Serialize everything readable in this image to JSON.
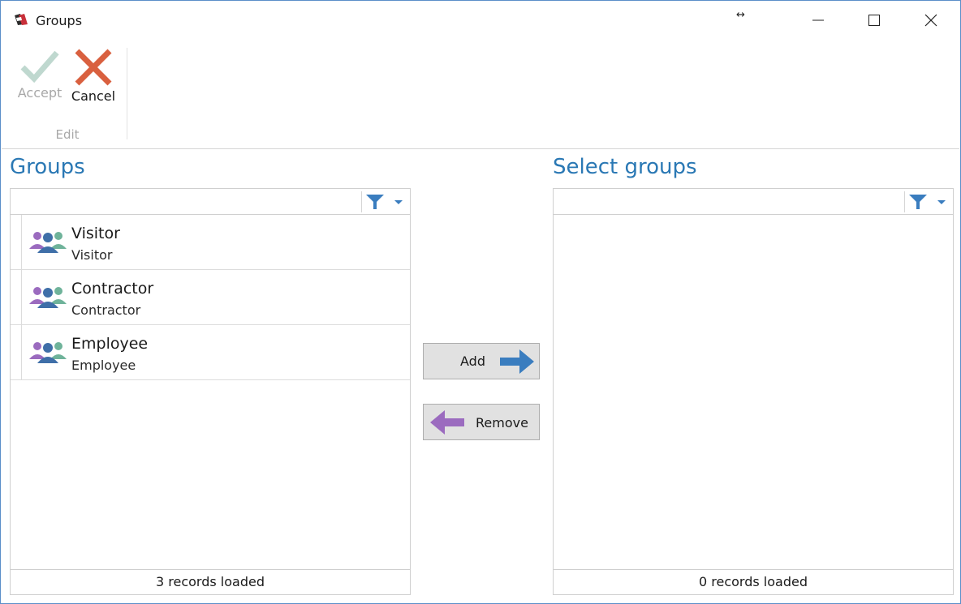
{
  "window": {
    "title": "Groups",
    "icon": "app-logo-icon",
    "controls": [
      "minimize-icon",
      "maximize-icon",
      "close-icon"
    ]
  },
  "ribbon": {
    "accept_label": "Accept",
    "cancel_label": "Cancel",
    "group_label": "Edit",
    "accept_color": "#bfd8cf",
    "cancel_color": "#d9603f"
  },
  "left_panel": {
    "title": "Groups",
    "filter_value": "",
    "items": [
      {
        "title": "Visitor",
        "subtitle": "Visitor",
        "icon": "group-icon"
      },
      {
        "title": "Contractor",
        "subtitle": "Contractor",
        "icon": "group-icon"
      },
      {
        "title": "Employee",
        "subtitle": "Employee",
        "icon": "group-icon"
      }
    ],
    "status": "3 records loaded"
  },
  "right_panel": {
    "title": "Select groups",
    "filter_value": "",
    "items": [],
    "status": "0 records loaded"
  },
  "actions": {
    "add_label": "Add",
    "remove_label": "Remove",
    "add_arrow_color": "#3a7dbf",
    "remove_arrow_color": "#9b6bbf"
  },
  "colors": {
    "accent": "#2a78b4",
    "group_purple": "#9b6bbf",
    "group_blue": "#3f6fa8",
    "group_green": "#6fb39a"
  }
}
